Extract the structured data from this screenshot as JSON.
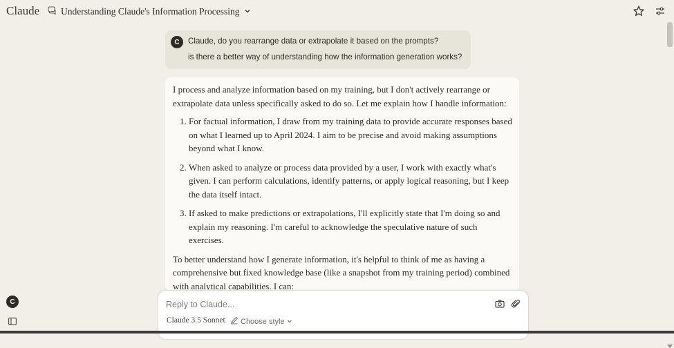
{
  "brand": "Claude",
  "chat_title": "Understanding Claude's Information Processing",
  "user_message": {
    "avatar": "C",
    "lines": [
      "Claude, do you rearrange data or extrapolate it based on the prompts?",
      "is there a better way of understanding how the information generation works?"
    ]
  },
  "response": {
    "intro": "I process and analyze information based on my training, but I don't actively rearrange or extrapolate data unless specifically asked to do so. Let me explain how I handle information:",
    "items": [
      "For factual information, I draw from my training data to provide accurate responses based on what I learned up to April 2024. I aim to be precise and avoid making assumptions beyond what I know.",
      "When asked to analyze or process data provided by a user, I work with exactly what's given. I can perform calculations, identify patterns, or apply logical reasoning, but I keep the data itself intact.",
      "If asked to make predictions or extrapolations, I'll explicitly state that I'm doing so and explain my reasoning. I'm careful to acknowledge the speculative nature of such exercises."
    ],
    "outro": "To better understand how I generate information, it's helpful to think of me as having a comprehensive but fixed knowledge base (like a snapshot from my training period) combined with analytical capabilities. I can:"
  },
  "sidebar": {
    "avatar": "C"
  },
  "composer": {
    "placeholder": "Reply to Claude...",
    "model": "Claude 3.5 Sonnet",
    "style": "Choose style"
  },
  "icons": {
    "chat": "chat-bubble-icon",
    "star": "star-icon",
    "settings": "sliders-icon",
    "camera": "camera-icon",
    "attach": "paperclip-icon",
    "sidebar": "sidebar-toggle-icon"
  },
  "colors": {
    "background": "#f1efe8",
    "user_bubble": "#e7e4da",
    "response_card": "#fbfaf7",
    "avatar": "#2c2b28"
  }
}
